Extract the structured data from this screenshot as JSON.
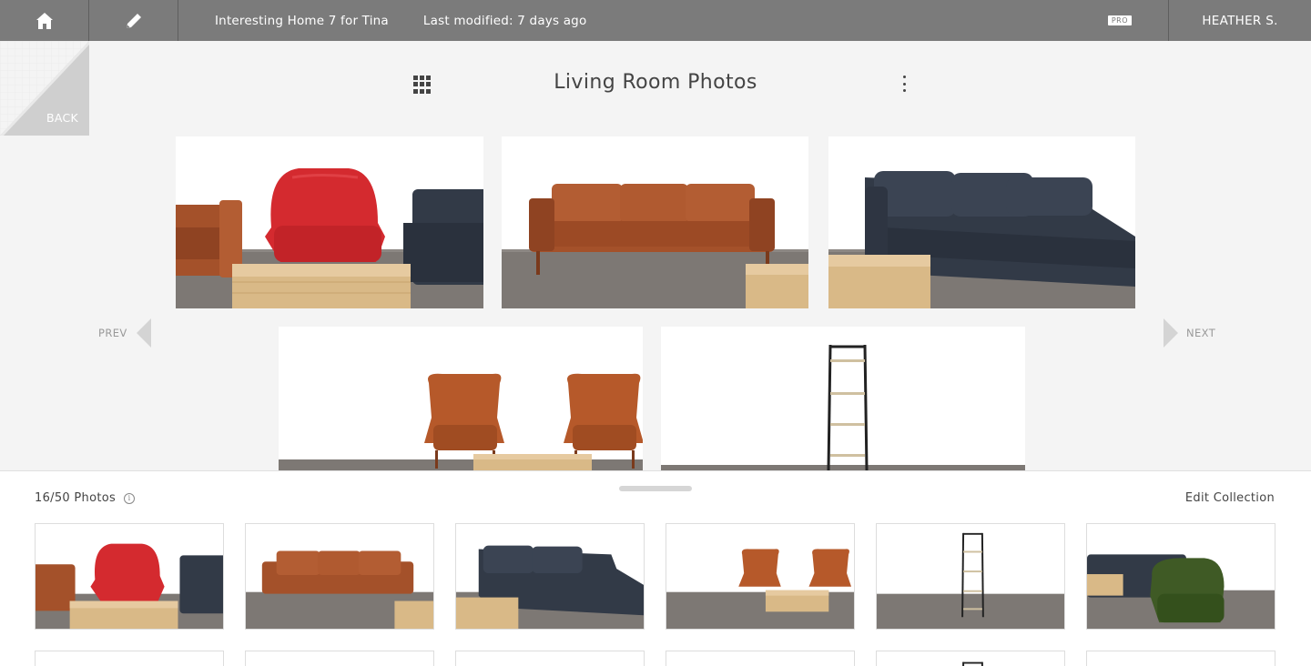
{
  "topbar": {
    "home_icon": "home-icon",
    "edit_icon": "pencil-icon",
    "project_title": "Interesting Home 7 for Tina",
    "last_modified": "Last modified: 7 days ago",
    "pro_badge": "PRO",
    "user_name": "HEATHER S."
  },
  "back": {
    "label": "BACK"
  },
  "header": {
    "title": "Living Room Photos",
    "grid_icon": "grid-icon",
    "menu_icon": "kebab-menu-icon"
  },
  "nav": {
    "prev": "PREV",
    "next": "NEXT"
  },
  "panel": {
    "count": "16/50 Photos",
    "info_glyph": "i",
    "edit_collection": "Edit Collection"
  },
  "colors": {
    "topbar": "#7b7b7b",
    "background": "#f4f4f4",
    "leather": "#a4512a",
    "red_chair": "#d42a2f",
    "navy_sofa": "#323a47",
    "green_chair": "#3f5a25",
    "wood_table": "#d9b987",
    "floor": "#7d7874"
  },
  "photos": [
    {
      "scene": "red-chair-set"
    },
    {
      "scene": "leather-sofa"
    },
    {
      "scene": "navy-chaise"
    },
    {
      "scene": "wing-chairs"
    },
    {
      "scene": "ladder-shelf"
    }
  ],
  "thumbnails": [
    {
      "scene": "red-chair-set"
    },
    {
      "scene": "leather-sofa"
    },
    {
      "scene": "navy-chaise"
    },
    {
      "scene": "wing-chairs"
    },
    {
      "scene": "ladder-shelf"
    },
    {
      "scene": "green-chair"
    }
  ]
}
